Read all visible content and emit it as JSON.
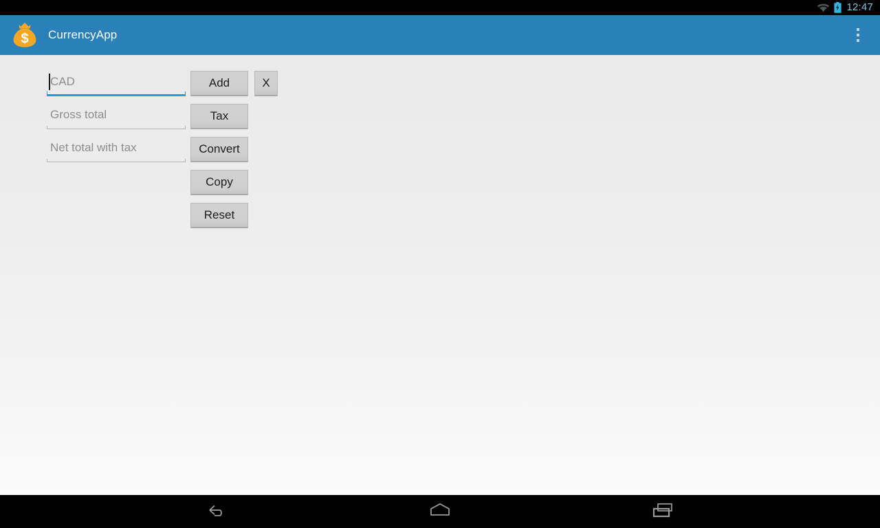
{
  "status_bar": {
    "clock": "12:47",
    "wifi_icon": "wifi-icon",
    "battery_icon": "battery-charging-icon",
    "clock_color": "#79c5e8",
    "background": "#000000"
  },
  "action_bar": {
    "title": "CurrencyApp",
    "app_icon": "money-bag-icon",
    "overflow_icon": "overflow-menu-icon",
    "background": "#2a81b9",
    "title_color": "#ffffff",
    "icon_color": "#f5a623"
  },
  "form": {
    "fields": [
      {
        "placeholder": "CAD",
        "value": "",
        "focused": true,
        "name": "currency-amount-input"
      },
      {
        "placeholder": "Gross total",
        "value": "",
        "focused": false,
        "name": "gross-total-input"
      },
      {
        "placeholder": "Net total with tax",
        "value": "",
        "focused": false,
        "name": "net-total-with-tax-input"
      }
    ],
    "focus_underline_color": "#1f9fd4",
    "underline_color": "#b4b4b4",
    "placeholder_color": "#8d8d8d"
  },
  "buttons": {
    "add": "Add",
    "clear": "X",
    "tax": "Tax",
    "convert": "Convert",
    "copy": "Copy",
    "reset": "Reset",
    "face_color": "#d0d0d0",
    "text_color": "#1c1c1c"
  },
  "nav_bar": {
    "back_icon": "back-icon",
    "home_icon": "home-icon",
    "recents_icon": "recents-icon",
    "background": "#000000",
    "icon_color": "#9a9a9a"
  }
}
